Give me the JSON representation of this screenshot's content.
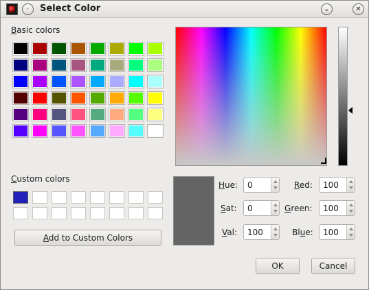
{
  "window": {
    "title": "Select Color",
    "icons": {
      "app": "app-icon",
      "sticky": "pin-icon",
      "shade": "chevron-down-icon",
      "close": "close-icon"
    }
  },
  "basic_colors": {
    "label_key": "B",
    "label_rest": "asic colors",
    "swatches": [
      "#000000",
      "#aa0000",
      "#005500",
      "#aa5500",
      "#00aa00",
      "#aaaa00",
      "#00ff00",
      "#aaff00",
      "#00007f",
      "#aa007f",
      "#00557f",
      "#aa557f",
      "#00aa7f",
      "#aaaa7f",
      "#00ff7f",
      "#aaff7f",
      "#0000ff",
      "#aa00ff",
      "#0055ff",
      "#aa55ff",
      "#00aaff",
      "#aaaaff",
      "#00ffff",
      "#aaffff",
      "#550000",
      "#ff0000",
      "#555500",
      "#ff5500",
      "#55aa00",
      "#ffaa00",
      "#55ff00",
      "#ffff00",
      "#55007f",
      "#ff007f",
      "#55557f",
      "#ff557f",
      "#55aa7f",
      "#ffaa7f",
      "#55ff7f",
      "#ffff7f",
      "#5500ff",
      "#ff00ff",
      "#5555ff",
      "#ff55ff",
      "#55aaff",
      "#ffaaff",
      "#55ffff",
      "#ffffff"
    ]
  },
  "custom_colors": {
    "label_key": "C",
    "label_rest": "ustom colors",
    "first_color": "#2222bb",
    "add_button_key": "A",
    "add_button_rest": "dd to Custom Colors"
  },
  "preview_color": "#646464",
  "fields": {
    "hue": {
      "key": "H",
      "rest": "ue:",
      "value": "0"
    },
    "sat": {
      "key": "S",
      "rest": "at:",
      "value": "0"
    },
    "val": {
      "key": "V",
      "rest": "al:",
      "value": "100"
    },
    "red": {
      "key": "R",
      "rest": "ed:",
      "value": "100"
    },
    "green": {
      "key": "G",
      "rest": "reen:",
      "value": "100"
    },
    "blue": {
      "key": "u",
      "prefix": "Bl",
      "rest": "e:",
      "value": "100"
    }
  },
  "buttons": {
    "ok": "OK",
    "cancel": "Cancel"
  }
}
